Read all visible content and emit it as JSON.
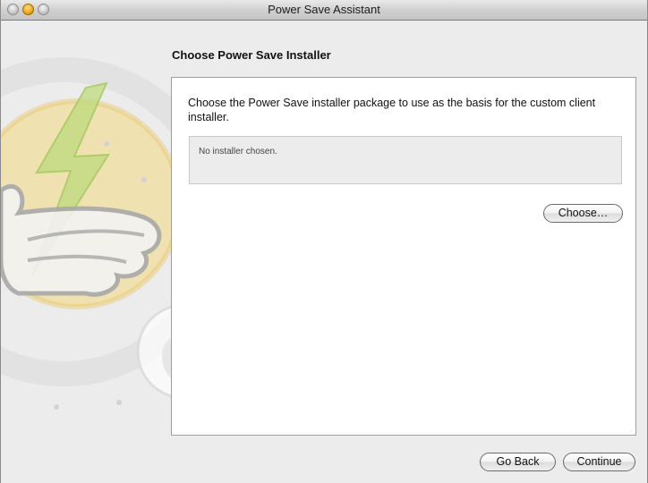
{
  "window": {
    "title": "Power Save Assistant",
    "traffic_lights": [
      "close",
      "minimize",
      "zoom"
    ]
  },
  "step": {
    "title": "Choose Power Save Installer",
    "instructions": "Choose the Power Save installer package to use as the basis for the custom client installer.",
    "file_status": "No installer chosen.",
    "choose_label": "Choose…"
  },
  "footer": {
    "back_label": "Go Back",
    "continue_label": "Continue"
  },
  "colors": {
    "accent_yellow": "#f2c94c",
    "lightning_green": "#a9d15a",
    "window_bg": "#ececec"
  },
  "icons": [
    "power-save-hand-lightning-icon",
    "apple-logo-icon"
  ]
}
